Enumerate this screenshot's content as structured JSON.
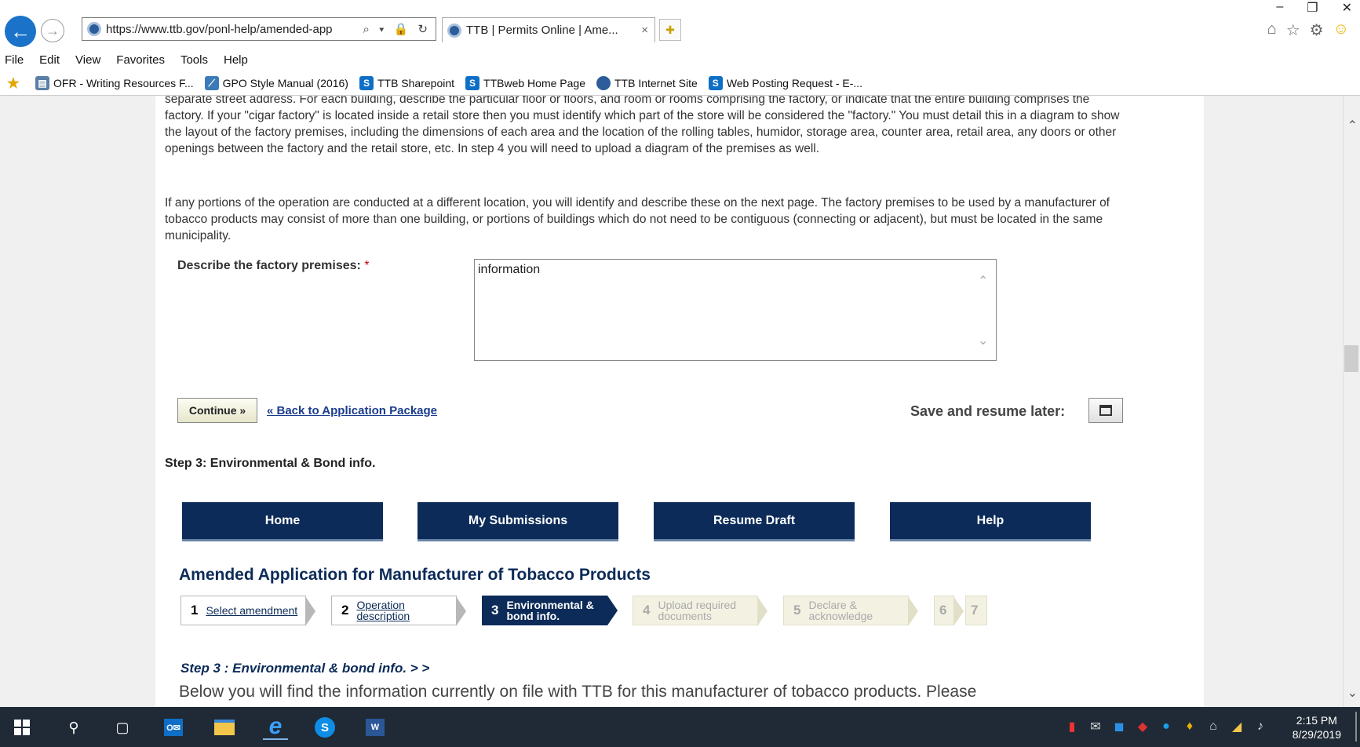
{
  "browser": {
    "url": "https://www.ttb.gov/ponl-help/amended-app",
    "address_tools": "⌕ ▾ 🔒 ↻",
    "tab_title": "TTB | Permits Online | Ame...",
    "tab_close": "×",
    "window_controls": [
      "–",
      "❐",
      "✕"
    ],
    "menu": [
      "File",
      "Edit",
      "View",
      "Favorites",
      "Tools",
      "Help"
    ],
    "favorites": [
      {
        "label": "OFR - Writing Resources F...",
        "icon": "ofr-icon"
      },
      {
        "label": "GPO Style Manual (2016)",
        "icon": "gpo-icon"
      },
      {
        "label": "TTB Sharepoint",
        "icon": "sharepoint-icon"
      },
      {
        "label": "TTBweb Home Page",
        "icon": "sharepoint-icon"
      },
      {
        "label": "TTB Internet Site",
        "icon": "ttb-icon"
      },
      {
        "label": "Web Posting Request - E-...",
        "icon": "sharepoint-icon"
      }
    ]
  },
  "page": {
    "para1": "separate street address. For each building, describe the particular floor or floors, and room or rooms comprising the factory, or indicate that the entire building comprises the factory. If your \"cigar factory\" is located inside a retail store then you must identify which part of the store will be considered the \"factory.\" You must detail this in a diagram to show the layout of the factory premises, including the dimensions of each area and the location of the rolling tables, humidor, storage area, counter area, retail area, any doors or other openings between the factory and the retail store, etc. In step 4 you will need to upload a diagram of the premises as well.",
    "para2": "If any portions of the operation are conducted at a different location, you will identify and describe these on the next page. The factory premises to be used by a manufacturer of tobacco products may consist of more than one building, or portions of buildings which do not need to be contiguous (connecting or adjacent), but must be located in the same municipality.",
    "describe_label": "Describe the factory premises:",
    "required_mark": "*",
    "describe_value": "information",
    "continue_label": "Continue »",
    "back_link": "« Back to Application Package",
    "save_label": "Save and resume later:",
    "step_heading": "Step 3: Environmental & Bond info.",
    "nav": [
      "Home",
      "My Submissions",
      "Resume Draft",
      "Help"
    ],
    "app_title": "Amended Application for Manufacturer of Tobacco Products",
    "wizard": [
      {
        "num": "1",
        "label": "Select amendment",
        "state": "done"
      },
      {
        "num": "2",
        "label": "Operation description",
        "state": "done"
      },
      {
        "num": "3",
        "label": "Environmental & bond info.",
        "state": "active"
      },
      {
        "num": "4",
        "label": "Upload required documents",
        "state": "todo"
      },
      {
        "num": "5",
        "label": "Declare & acknowledge",
        "state": "todo"
      },
      {
        "num": "6",
        "label": "",
        "state": "todo"
      },
      {
        "num": "7",
        "label": "",
        "state": "todo"
      }
    ],
    "sub_heading": "Step 3 : Environmental & bond info. > >",
    "intro": "Below you will find the information currently on file with TTB for this manufacturer of tobacco products. Please"
  },
  "taskbar": {
    "time": "2:15 PM",
    "date": "8/29/2019"
  },
  "colors": {
    "nav_bg": "#0c2b58",
    "link": "#1a3c8c",
    "required": "#cc0000"
  }
}
